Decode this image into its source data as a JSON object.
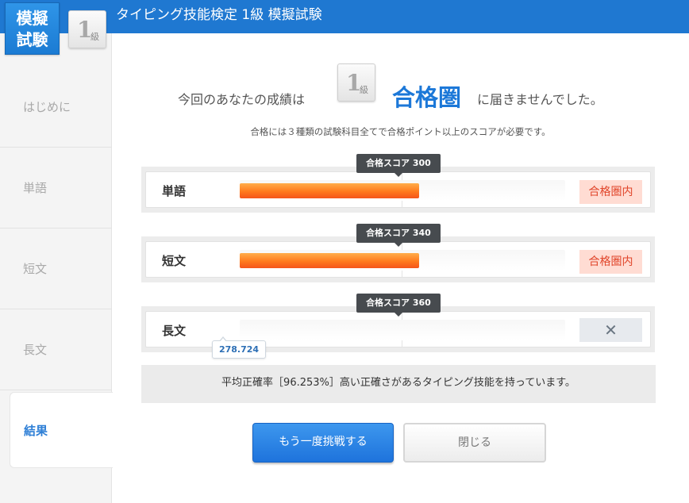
{
  "header": {
    "title": "タイピング技能検定 1級 模擬試験",
    "logo_line1": "模擬",
    "logo_line2": "試験",
    "grade_number": "1",
    "grade_unit": "級"
  },
  "sidebar": {
    "items": [
      {
        "label": "はじめに",
        "active": false
      },
      {
        "label": "単語",
        "active": false
      },
      {
        "label": "短文",
        "active": false
      },
      {
        "label": "長文",
        "active": false
      },
      {
        "label": "結果",
        "active": true
      }
    ]
  },
  "result": {
    "prefix": "今回のあなたの成績は",
    "grade_number": "1",
    "grade_unit": "級",
    "highlight": "合格圏",
    "suffix": "に届きませんでした。",
    "note": "合格には３種類の試験科目全てで合格ポイント以上のスコアが必要です。"
  },
  "subjects": [
    {
      "name": "単語",
      "pass_label": "合格スコア 300",
      "pass_score": 300,
      "fill_fraction": 0.55,
      "status": "合格圏内"
    },
    {
      "name": "短文",
      "pass_label": "合格スコア 340",
      "pass_score": 340,
      "fill_fraction": 0.55,
      "status": "合格圏内"
    },
    {
      "name": "長文",
      "pass_label": "合格スコア 360",
      "pass_score": 360,
      "score": "278.724",
      "fill_fraction": 0,
      "status": "✕"
    }
  ],
  "accuracy": "平均正確率［96.253%］高い正確さがあるタイピング技能を持っています。",
  "buttons": {
    "retry": "もう一度挑戦する",
    "close": "閉じる"
  },
  "colors": {
    "header": "#1f78d1",
    "accent": "#1c78d8",
    "bar_fill": "#ff7a1d",
    "pass_badge_bg": "#ffdcd3",
    "pass_badge_text": "#e1462b"
  }
}
